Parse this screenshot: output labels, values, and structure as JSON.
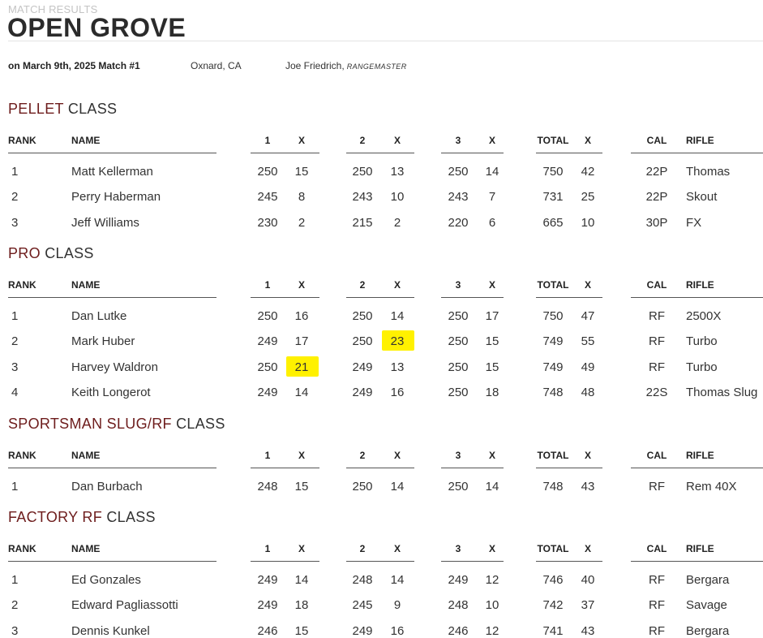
{
  "page": {
    "kicker": "MATCH RESULTS",
    "title": "OPEN GROVE",
    "date": "on March 9th, 2025 Match #1",
    "location": "Oxnard, CA",
    "rangemaster_name": "Joe Friedrich,",
    "rangemaster_role": "RANGEMASTER"
  },
  "colors": {
    "accent": "#6d1c1c",
    "highlight": "#fff100"
  },
  "columns": [
    "RANK",
    "NAME",
    "1",
    "X",
    "2",
    "X",
    "3",
    "X",
    "TOTAL",
    "X",
    "CAL",
    "RIFLE"
  ],
  "sections": [
    {
      "accent": "PELLET",
      "rest": " CLASS",
      "rows": [
        [
          "1",
          "Matt Kellerman",
          "250",
          "15",
          "250",
          "13",
          "250",
          "14",
          "750",
          "42",
          "22P",
          "Thomas"
        ],
        [
          "2",
          "Perry Haberman",
          "245",
          "8",
          "243",
          "10",
          "243",
          "7",
          "731",
          "25",
          "22P",
          "Skout"
        ],
        [
          "3",
          "Jeff Williams",
          "230",
          "2",
          "215",
          "2",
          "220",
          "6",
          "665",
          "10",
          "30P",
          "FX"
        ]
      ]
    },
    {
      "accent": "PRO",
      "rest": " CLASS",
      "rows": [
        [
          "1",
          "Dan Lutke",
          "250",
          "16",
          "250",
          "14",
          "250",
          "17",
          "750",
          "47",
          "RF",
          "2500X"
        ],
        [
          "2",
          "Mark Huber",
          "249",
          "17",
          "250",
          "23",
          "250",
          "15",
          "749",
          "55",
          "RF",
          "Turbo"
        ],
        [
          "3",
          "Harvey Waldron",
          "250",
          "21",
          "249",
          "13",
          "250",
          "15",
          "749",
          "49",
          "RF",
          "Turbo"
        ],
        [
          "4",
          "Keith Longerot",
          "249",
          "14",
          "249",
          "16",
          "250",
          "18",
          "748",
          "48",
          "22S",
          "Thomas Slug"
        ]
      ]
    },
    {
      "accent": "SPORTSMAN SLUG/RF",
      "rest": " CLASS",
      "rows": [
        [
          "1",
          "Dan Burbach",
          "248",
          "15",
          "250",
          "14",
          "250",
          "14",
          "748",
          "43",
          "RF",
          "Rem 40X"
        ]
      ]
    },
    {
      "accent": "FACTORY RF",
      "rest": " CLASS",
      "rows": [
        [
          "1",
          "Ed Gonzales",
          "249",
          "14",
          "248",
          "14",
          "249",
          "12",
          "746",
          "40",
          "RF",
          "Bergara"
        ],
        [
          "2",
          "Edward Pagliassotti",
          "249",
          "18",
          "245",
          "9",
          "248",
          "10",
          "742",
          "37",
          "RF",
          "Savage"
        ],
        [
          "3",
          "Dennis Kunkel",
          "246",
          "15",
          "249",
          "16",
          "246",
          "12",
          "741",
          "43",
          "RF",
          "Bergara"
        ]
      ]
    }
  ],
  "highlighted_cells": [
    {
      "section": 1,
      "row": 1,
      "col": 5
    },
    {
      "section": 1,
      "row": 2,
      "col": 3
    }
  ]
}
